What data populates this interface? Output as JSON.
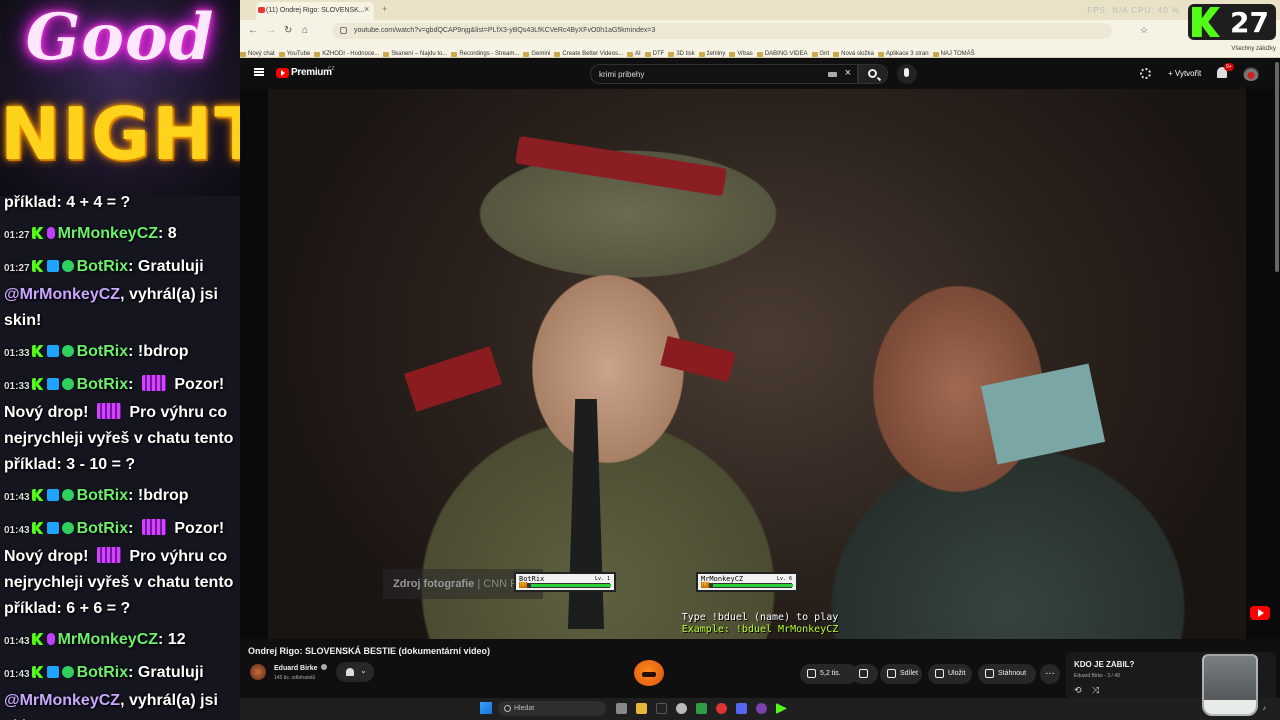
{
  "overlay": {
    "banner_top": "Good",
    "banner_bottom": "NIGHT",
    "chat": [
      {
        "time": "",
        "user": "",
        "parts": [
          {
            "t": "text",
            "v": "příklad: 4 + 4 = ?"
          }
        ],
        "badges": []
      },
      {
        "time": "01:27",
        "user": "MrMonkeyCZ",
        "badges": [
          "kick",
          "mic"
        ],
        "parts": [
          {
            "t": "text",
            "v": ": 8"
          }
        ]
      },
      {
        "time": "01:27",
        "user": "BotRix",
        "badges": [
          "kick",
          "bot",
          "verified"
        ],
        "parts": [
          {
            "t": "text",
            "v": ": Gratuluji "
          },
          {
            "t": "mention",
            "v": "@MrMonkeyCZ"
          },
          {
            "t": "text",
            "v": ", vyhrál(a) jsi skin!"
          }
        ]
      },
      {
        "time": "01:33",
        "user": "BotRix",
        "badges": [
          "kick",
          "bot",
          "verified"
        ],
        "parts": [
          {
            "t": "text",
            "v": ": !bdrop"
          }
        ]
      },
      {
        "time": "01:33",
        "user": "BotRix",
        "badges": [
          "kick",
          "bot",
          "verified"
        ],
        "parts": [
          {
            "t": "text",
            "v": ": "
          },
          {
            "t": "emote",
            "v": ""
          },
          {
            "t": "text",
            "v": " Pozor! Nový drop! "
          },
          {
            "t": "emote",
            "v": ""
          },
          {
            "t": "text",
            "v": " Pro výhru co nejrychleji vyřeš v chatu tento příklad: 3 - 10 = ?"
          }
        ]
      },
      {
        "time": "01:43",
        "user": "BotRix",
        "badges": [
          "kick",
          "bot",
          "verified"
        ],
        "parts": [
          {
            "t": "text",
            "v": ": !bdrop"
          }
        ]
      },
      {
        "time": "01:43",
        "user": "BotRix",
        "badges": [
          "kick",
          "bot",
          "verified"
        ],
        "parts": [
          {
            "t": "text",
            "v": ": "
          },
          {
            "t": "emote",
            "v": ""
          },
          {
            "t": "text",
            "v": " Pozor! Nový drop! "
          },
          {
            "t": "emote",
            "v": ""
          },
          {
            "t": "text",
            "v": " Pro výhru co nejrychleji vyřeš v chatu tento příklad: 6 + 6 = ?"
          }
        ]
      },
      {
        "time": "01:43",
        "user": "MrMonkeyCZ",
        "badges": [
          "kick",
          "mic"
        ],
        "parts": [
          {
            "t": "text",
            "v": ": 12"
          }
        ]
      },
      {
        "time": "01:43",
        "user": "BotRix",
        "badges": [
          "kick",
          "bot",
          "verified"
        ],
        "parts": [
          {
            "t": "text",
            "v": ": Gratuluji "
          },
          {
            "t": "mention",
            "v": "@MrMonkeyCZ"
          },
          {
            "t": "text",
            "v": ", vyhrál(a) jsi skin!"
          }
        ]
      }
    ],
    "kick_viewers": "27"
  },
  "browser": {
    "tab_title": "(11) Ondrej Rigo: SLOVENSK...",
    "tab_close": "×",
    "tab_new": "+",
    "tray_text": "FPS: N/A   CPU: 40 %",
    "url": "youtube.com/watch?v=gbdQCAP9njg&list=PLfX3-yBQs43LfKCVeRc4ByXFvO0h1aG5kmindex=3",
    "bookmarks": [
      "Nový chat",
      "YouTube",
      "KZHODI - Hodnoce...",
      "Skanení – Najdu to...",
      "Recordings - Stream...",
      "Gemini",
      "Create Better Videos...",
      "AI",
      "DTF",
      "3D tisk",
      "žehliny",
      "Vrbas",
      "DABING VIDEA",
      "Grit",
      "Nová složka",
      "Aplikace 3 stran",
      "NAJ TOMÁŠ"
    ],
    "bookmarks_all": "Všechny záložky"
  },
  "youtube": {
    "logo_text": "Premium",
    "logo_region": "CZ",
    "search_value": "krimi pribehy",
    "create_label": "Vytvořit",
    "notif_count": "9+",
    "watermark_label": "Zdroj fotografie",
    "watermark_brand": "CNN Prima",
    "duel": {
      "left_name": "BotRix",
      "left_level": "Lv. 1",
      "left_hp": 0.98,
      "right_name": "MrMonkeyCZ",
      "right_level": "Lv. 6",
      "right_hp": 0.98,
      "hp_label": "HP",
      "line1": "Type !bduel (name) to play",
      "line2": "Example: !bduel MrMonkeyCZ"
    },
    "video_title": "Ondrej Rigo: SLOVENSKÁ BESTIE (dokumentární video)",
    "channel_name": "Eduard Birke",
    "subscribers": "145 tis. odběratelů",
    "likes": "5,2 tis.",
    "share_label": "Sdílet",
    "save_label": "Uložit",
    "download_label": "Stáhnout",
    "more_label": "…",
    "mix_title": "KDO JE ZABIL?",
    "mix_sub": "Eduard Birke - 3 / 48"
  },
  "taskbar": {
    "search_placeholder": "Hledat"
  }
}
